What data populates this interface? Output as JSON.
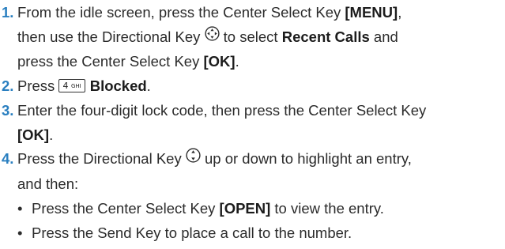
{
  "steps": [
    {
      "number": "1.",
      "line1_pre": "From the idle screen, press the Center Select Key ",
      "line1_key": "[MENU]",
      "line1_post": ",",
      "line2_pre": "then use the Directional Key ",
      "line2_icon": "four-way-directional-key-icon",
      "line2_mid": " to select ",
      "line2_bold": "Recent Calls",
      "line2_post": " and",
      "line3_pre": "press the Center Select Key ",
      "line3_key": "[OK]",
      "line3_post": "."
    },
    {
      "number": "2.",
      "pre": "Press ",
      "keycap_main": "4",
      "keycap_sub": "GHI",
      "bold": "Blocked",
      "post": "."
    },
    {
      "number": "3.",
      "line1": "Enter the four-digit lock code, then press the Center Select Key",
      "line2_key": "[OK]",
      "line2_post": "."
    },
    {
      "number": "4.",
      "line1_pre": "Press the Directional Key ",
      "line1_icon": "up-down-directional-key-icon",
      "line1_post": " up or down to highlight an entry,",
      "line2": "and then:",
      "bullets": [
        {
          "pre": "Press the Center Select Key ",
          "key": "[OPEN]",
          "post": " to view the entry."
        },
        {
          "text": "Press the Send Key to place a call to the number."
        }
      ]
    }
  ],
  "bullet_char": "•",
  "colors": {
    "step_number": "#2a7fc0",
    "text": "#2b2b2b"
  }
}
